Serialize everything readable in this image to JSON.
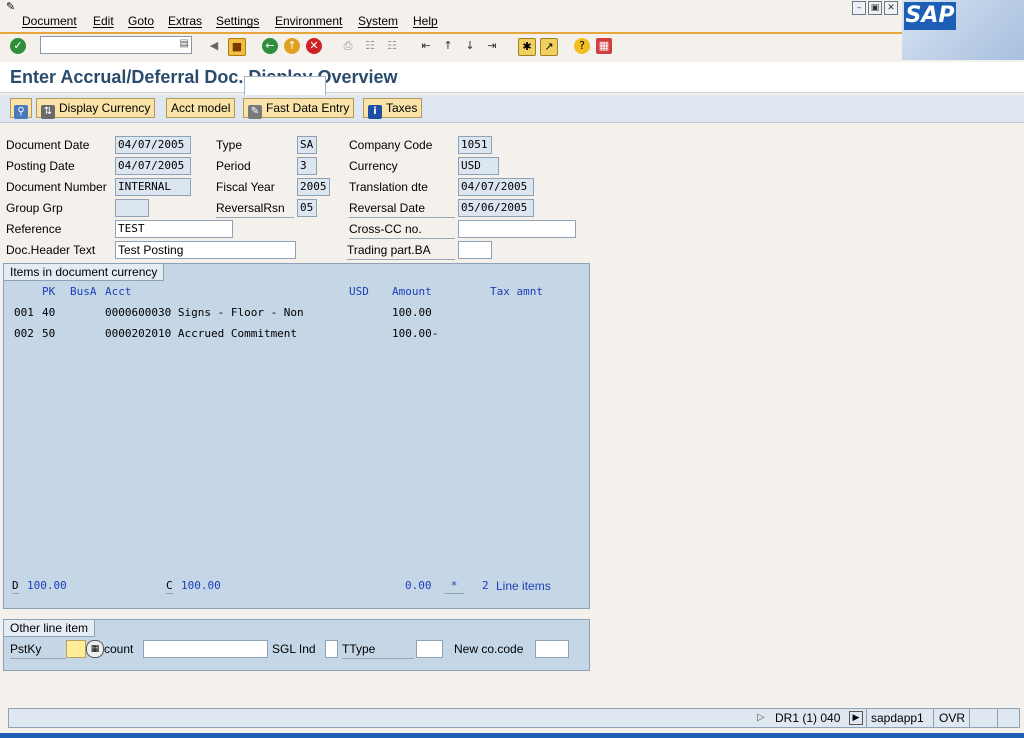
{
  "menu": {
    "items": [
      "Document",
      "Edit",
      "Goto",
      "Extras",
      "Settings",
      "Environment",
      "System",
      "Help"
    ]
  },
  "brand": {
    "logo_text": "SAP"
  },
  "toolbar": {
    "icons": [
      "enter-icon",
      "command-field",
      "back-arrow-icon",
      "save-icon",
      "back-icon",
      "exit-icon",
      "cancel-icon",
      "print-icon",
      "find-icon",
      "find-next-icon",
      "first-page-icon",
      "previous-page-icon",
      "next-page-icon",
      "last-page-icon",
      "create-session-icon",
      "shortcut-icon",
      "help-icon",
      "customize-layout-icon"
    ]
  },
  "page": {
    "title": "Enter Accrual/Deferral Doc. Display Overview"
  },
  "app_toolbar": {
    "display_currency": "Display Currency",
    "acct_model": "Acct model",
    "fast_data_entry": "Fast Data Entry",
    "taxes": "Taxes"
  },
  "header": {
    "document_date": {
      "label": "Document Date",
      "value": "04/07/2005"
    },
    "posting_date": {
      "label": "Posting Date",
      "value": "04/07/2005"
    },
    "document_number": {
      "label": "Document Number",
      "value": "INTERNAL"
    },
    "group_grp": {
      "label": "Group Grp",
      "value": ""
    },
    "reference": {
      "label": "Reference",
      "value": "TEST"
    },
    "doc_header_text": {
      "label": "Doc.Header Text",
      "value": "Test Posting"
    },
    "type": {
      "label": "Type",
      "value": "SA"
    },
    "period": {
      "label": "Period",
      "value": "3"
    },
    "fiscal_year": {
      "label": "Fiscal Year",
      "value": "2005"
    },
    "reversal_rsn": {
      "label": "ReversalRsn",
      "value": "05"
    },
    "company_code": {
      "label": "Company Code",
      "value": "1051"
    },
    "currency": {
      "label": "Currency",
      "value": "USD"
    },
    "translation_dte": {
      "label": "Translation dte",
      "value": "04/07/2005"
    },
    "reversal_date": {
      "label": "Reversal Date",
      "value": "05/06/2005"
    },
    "cross_cc_no": {
      "label": "Cross-CC no.",
      "value": ""
    },
    "trading_part_ba": {
      "label": "Trading part.BA",
      "value": ""
    }
  },
  "items": {
    "tab_label": "Items in document currency",
    "columns": {
      "pk": "PK",
      "busa": "BusA",
      "acct": "Acct",
      "currency": "USD",
      "amount": "Amount",
      "tax": "Tax amnt"
    },
    "rows": [
      {
        "line": "001",
        "pk": "40",
        "busa": "",
        "acct": "0000600030 Signs - Floor - Non",
        "amount": "100.00"
      },
      {
        "line": "002",
        "pk": "50",
        "busa": "",
        "acct": "0000202010 Accrued Commitment",
        "amount": "100.00-"
      }
    ],
    "totals": {
      "debit_label": "D",
      "debit_value": "100.00",
      "credit_label": "C",
      "credit_value": "100.00",
      "balance": "0.00",
      "balance_flag": "*",
      "line_count": "2",
      "line_items_label": "Line items"
    }
  },
  "other_line_item": {
    "tab_label": "Other line item",
    "pstky_label": "PstKy",
    "account_label": "count",
    "sgl_ind_label": "SGL Ind",
    "ttype_label": "TType",
    "new_cocode_label": "New co.code"
  },
  "status_bar": {
    "system": "DR1 (1) 040",
    "server": "sapdapp1",
    "mode": "OVR"
  },
  "colors": {
    "accent_orange": "#e8a73a",
    "title_blue": "#2b4b6d",
    "panel_blue": "#c5d6e7",
    "readonly_field": "#dbe6f1",
    "button_yellow": "#f9e3a8",
    "value_blue": "#1b3fb6",
    "sap_brand": "#1d5fb4"
  }
}
